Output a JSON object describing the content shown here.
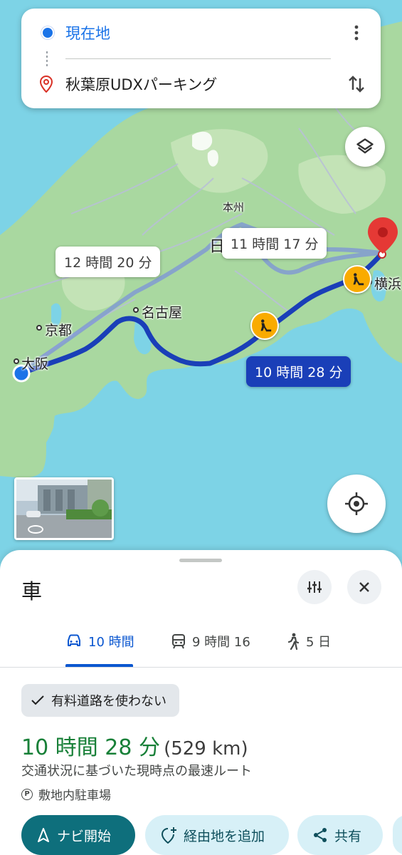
{
  "search": {
    "origin": "現在地",
    "destination": "秋葉原UDXパーキング"
  },
  "map": {
    "labels": {
      "honshu": "本州",
      "kyoto": "京都",
      "osaka": "大阪",
      "nagoya": "名古屋",
      "yokohama": "横浜",
      "partial_label": "日"
    },
    "route_bubbles": {
      "alt_route_1": "12 時間 20 分",
      "alt_route_2": "11 時間 17 分",
      "selected_route": "10 時間 28 分"
    },
    "colors": {
      "water": "#7dd3e6",
      "land": "#a9d8a0",
      "selected_route": "#1a3fb8",
      "alt_route": "#9fb3e8",
      "destination_pin": "#e53935",
      "origin_dot": "#1a73e8",
      "construction_badge": "#f9ab00"
    }
  },
  "sheet": {
    "title": "車",
    "tabs": [
      {
        "icon": "car-icon",
        "label": "10 時間"
      },
      {
        "icon": "train-icon",
        "label": "9 時間 16"
      },
      {
        "icon": "walk-icon",
        "label": "5 日"
      }
    ],
    "selected_tab": 0,
    "filter_chip": "有料道路を使わない",
    "duration": "10 時間 28 分",
    "distance": "(529 km)",
    "route_description": "交通状況に基づいた現時点の最速ルート",
    "parking_info": "敷地内駐車場",
    "parking_badge": "P",
    "actions": {
      "start_navigation": "ナビ開始",
      "add_stop": "経由地を追加",
      "share": "共有"
    },
    "colors": {
      "duration": "#188038",
      "active_tab": "#0b57d0",
      "primary_button": "#0e6f7c"
    }
  }
}
